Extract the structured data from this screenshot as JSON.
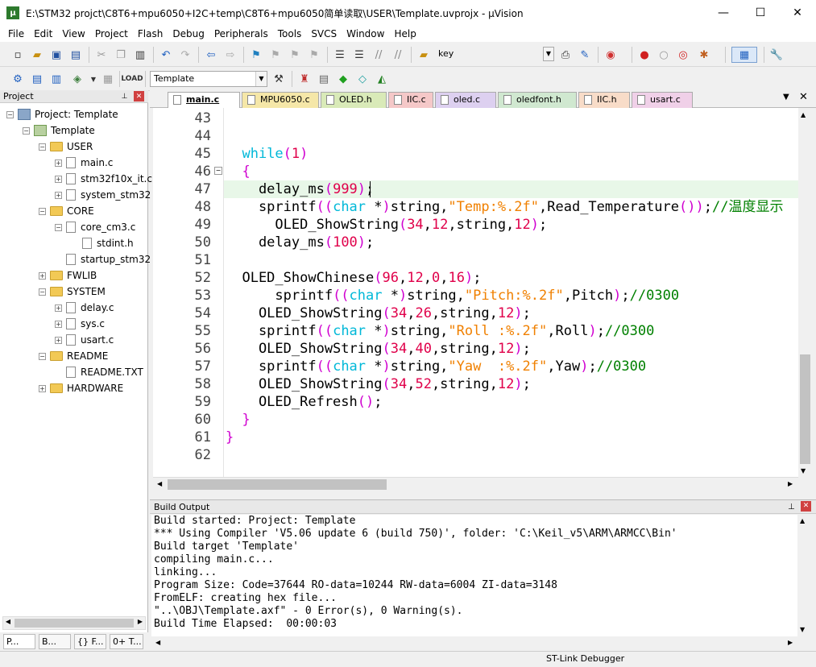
{
  "window": {
    "title": "E:\\STM32 projct\\C8T6+mpu6050+I2C+temp\\C8T6+mpu6050简单读取\\USER\\Template.uvprojx - µVision",
    "min": "—",
    "max": "☐",
    "close": "✕"
  },
  "menu": [
    "File",
    "Edit",
    "View",
    "Project",
    "Flash",
    "Debug",
    "Peripherals",
    "Tools",
    "SVCS",
    "Window",
    "Help"
  ],
  "toolbar": {
    "find_value": "key",
    "target_value": "Template"
  },
  "project_panel": {
    "title": "Project",
    "pin": "⊥",
    "close": "✕",
    "tree": [
      {
        "label": "Project: Template",
        "kind": "project",
        "level": 0,
        "exp": "−"
      },
      {
        "label": "Template",
        "kind": "group",
        "level": 1,
        "exp": "−"
      },
      {
        "label": "USER",
        "kind": "folder",
        "level": 2,
        "exp": "−"
      },
      {
        "label": "main.c",
        "kind": "file",
        "level": 3,
        "exp": "+"
      },
      {
        "label": "stm32f10x_it.c",
        "kind": "file",
        "level": 3,
        "exp": "+"
      },
      {
        "label": "system_stm32",
        "kind": "file",
        "level": 3,
        "exp": "+"
      },
      {
        "label": "CORE",
        "kind": "folder",
        "level": 2,
        "exp": "−"
      },
      {
        "label": "core_cm3.c",
        "kind": "file",
        "level": 3,
        "exp": "−"
      },
      {
        "label": "stdint.h",
        "kind": "file",
        "level": 4,
        "exp": ""
      },
      {
        "label": "startup_stm32",
        "kind": "file",
        "level": 3,
        "exp": ""
      },
      {
        "label": "FWLIB",
        "kind": "folder",
        "level": 2,
        "exp": "+"
      },
      {
        "label": "SYSTEM",
        "kind": "folder",
        "level": 2,
        "exp": "−"
      },
      {
        "label": "delay.c",
        "kind": "file",
        "level": 3,
        "exp": "+"
      },
      {
        "label": "sys.c",
        "kind": "file",
        "level": 3,
        "exp": "+"
      },
      {
        "label": "usart.c",
        "kind": "file",
        "level": 3,
        "exp": "+"
      },
      {
        "label": "README",
        "kind": "folder",
        "level": 2,
        "exp": "−"
      },
      {
        "label": "README.TXT",
        "kind": "file",
        "level": 3,
        "exp": ""
      },
      {
        "label": "HARDWARE",
        "kind": "folder",
        "level": 2,
        "exp": "+"
      }
    ],
    "tabs": [
      "P...",
      "B...",
      "{} F...",
      "0+ T..."
    ]
  },
  "file_tabs": [
    {
      "label": "main.c",
      "color": "#f7f7f7",
      "active": true
    },
    {
      "label": "MPU6050.c",
      "color": "#f5e7a8"
    },
    {
      "label": "OLED.h",
      "color": "#d9eab8"
    },
    {
      "label": "IIC.c",
      "color": "#f5c8c8"
    },
    {
      "label": "oled.c",
      "color": "#ddd0f0"
    },
    {
      "label": "oledfont.h",
      "color": "#d0e8d0"
    },
    {
      "label": "IIC.h",
      "color": "#f8dcc8"
    },
    {
      "label": "usart.c",
      "color": "#f0d0e8"
    }
  ],
  "code_lines": [
    {
      "n": "43",
      "html": ""
    },
    {
      "n": "44",
      "html": ""
    },
    {
      "n": "45",
      "html": "  <span class='kw'>while</span><span class='br'>(</span><span class='num'>1</span><span class='br'>)</span>"
    },
    {
      "n": "46",
      "html": "  <span class='br'>{</span>"
    },
    {
      "n": "47",
      "html": "    delay_ms<span class='br'>(</span><span class='num'>999</span><span class='br'>)</span>;"
    },
    {
      "n": "48",
      "html": "    sprintf<span class='br'>((</span><span class='kw'>char</span> *<span class='br'>)</span>string,<span class='str'>\"Temp:%.2f\"</span>,Read_Temperature<span class='br'>())</span>;<span class='cm'>//温度显示</span>"
    },
    {
      "n": "49",
      "html": "      OLED_ShowString<span class='br'>(</span><span class='num'>34</span>,<span class='num'>12</span>,string,<span class='num'>12</span><span class='br'>)</span>;"
    },
    {
      "n": "50",
      "html": "    delay_ms<span class='br'>(</span><span class='num'>100</span><span class='br'>)</span>;"
    },
    {
      "n": "51",
      "html": ""
    },
    {
      "n": "52",
      "html": "  OLED_ShowChinese<span class='br'>(</span><span class='num'>96</span>,<span class='num'>12</span>,<span class='num'>0</span>,<span class='num'>16</span><span class='br'>)</span>;"
    },
    {
      "n": "53",
      "html": "      sprintf<span class='br'>((</span><span class='kw'>char</span> *<span class='br'>)</span>string,<span class='str'>\"Pitch:%.2f\"</span>,Pitch<span class='br'>)</span>;<span class='cm'>//0300</span>"
    },
    {
      "n": "54",
      "html": "    OLED_ShowString<span class='br'>(</span><span class='num'>34</span>,<span class='num'>26</span>,string,<span class='num'>12</span><span class='br'>)</span>;"
    },
    {
      "n": "55",
      "html": "    sprintf<span class='br'>((</span><span class='kw'>char</span> *<span class='br'>)</span>string,<span class='str'>\"Roll :%.2f\"</span>,Roll<span class='br'>)</span>;<span class='cm'>//0300</span>"
    },
    {
      "n": "56",
      "html": "    OLED_ShowString<span class='br'>(</span><span class='num'>34</span>,<span class='num'>40</span>,string,<span class='num'>12</span><span class='br'>)</span>;"
    },
    {
      "n": "57",
      "html": "    sprintf<span class='br'>((</span><span class='kw'>char</span> *<span class='br'>)</span>string,<span class='str'>\"Yaw  :%.2f\"</span>,Yaw<span class='br'>)</span>;<span class='cm'>//0300</span>"
    },
    {
      "n": "58",
      "html": "    OLED_ShowString<span class='br'>(</span><span class='num'>34</span>,<span class='num'>52</span>,string,<span class='num'>12</span><span class='br'>)</span>;"
    },
    {
      "n": "59",
      "html": "    OLED_Refresh<span class='br'>()</span>;"
    },
    {
      "n": "60",
      "html": "  <span class='br'>}</span>"
    },
    {
      "n": "61",
      "html": "<span class='br'>}</span>"
    },
    {
      "n": "62",
      "html": ""
    }
  ],
  "build": {
    "title": "Build Output",
    "lines": [
      "Build started: Project: Template",
      "*** Using Compiler 'V5.06 update 6 (build 750)', folder: 'C:\\Keil_v5\\ARM\\ARMCC\\Bin'",
      "Build target 'Template'",
      "compiling main.c...",
      "linking...",
      "Program Size: Code=37644 RO-data=10244 RW-data=6004 ZI-data=3148",
      "FromELF: creating hex file...",
      "\"..\\OBJ\\Template.axf\" - 0 Error(s), 0 Warning(s).",
      "Build Time Elapsed:  00:00:03"
    ]
  },
  "status": {
    "debugger": "ST-Link Debugger"
  }
}
